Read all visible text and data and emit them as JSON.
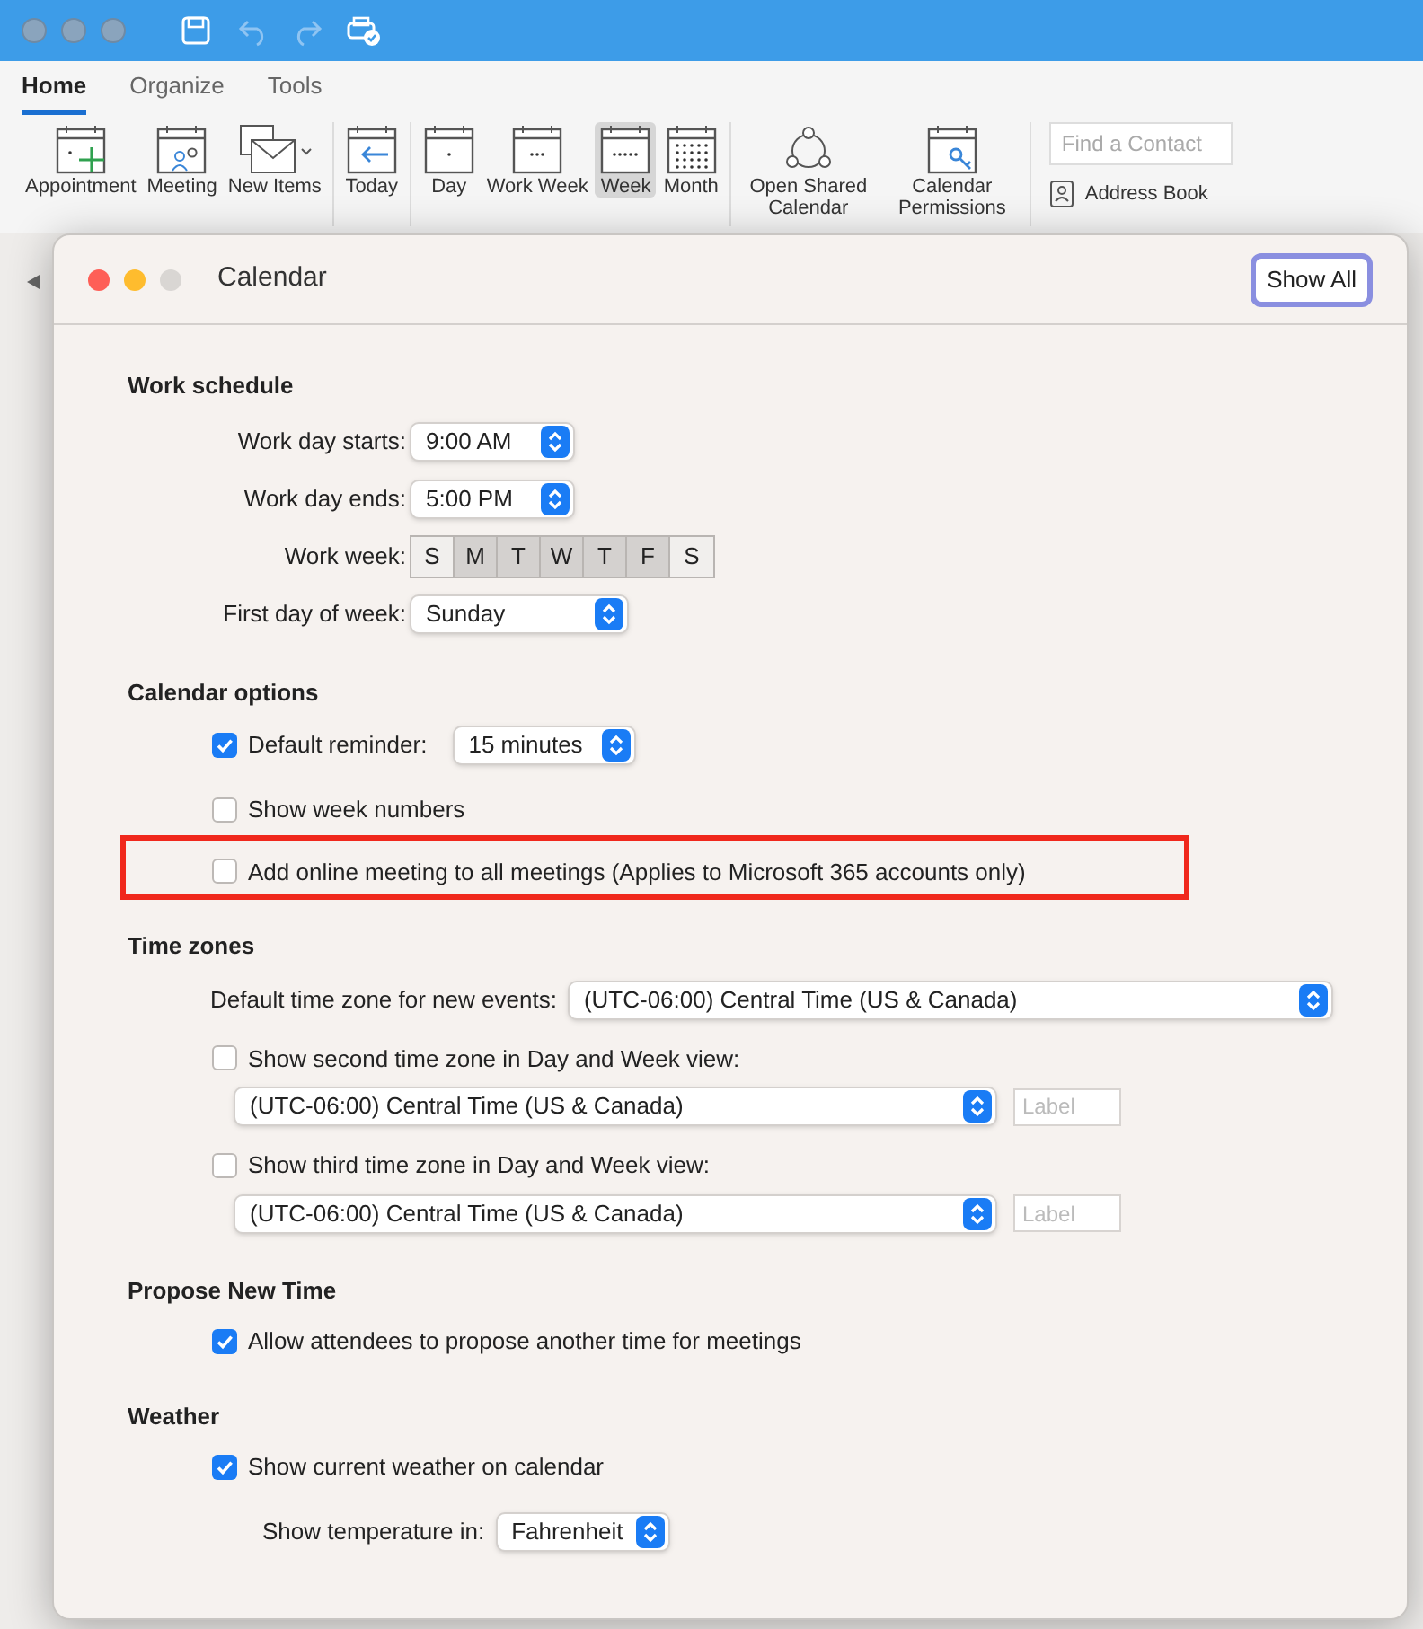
{
  "app": {
    "tabs": [
      {
        "label": "Home",
        "selected": true
      },
      {
        "label": "Organize",
        "selected": false
      },
      {
        "label": "Tools",
        "selected": false
      }
    ],
    "ribbon": [
      [
        {
          "kind": "appointment",
          "label": "Appointment",
          "selected": false
        },
        {
          "kind": "meeting",
          "label": "Meeting",
          "selected": false
        },
        {
          "kind": "new",
          "label": "New Items",
          "selected": false
        }
      ],
      [
        {
          "kind": "today",
          "label": "Today",
          "selected": false
        }
      ],
      [
        {
          "kind": "day",
          "label": "Day",
          "selected": false
        },
        {
          "kind": "workweek",
          "label": "Work Week",
          "selected": false
        },
        {
          "kind": "week",
          "label": "Week",
          "selected": true
        },
        {
          "kind": "month",
          "label": "Month",
          "selected": false
        }
      ],
      [
        {
          "kind": "shared",
          "label": "Open Shared Calendar",
          "selected": false
        },
        {
          "kind": "permissions",
          "label": "Calendar Permissions",
          "selected": false
        }
      ]
    ],
    "search": {
      "placeholder": "Find a Contact"
    },
    "address_book": "Address Book"
  },
  "dialog": {
    "title": "Calendar",
    "show_all": "Show All",
    "sections": [
      {
        "kind": "form",
        "title": "Work schedule",
        "rows": [
          {
            "kind": "time_select",
            "label": "Work day starts:",
            "value": "9:00 AM"
          },
          {
            "kind": "time_select",
            "label": "Work day ends:",
            "value": "5:00 PM"
          },
          {
            "kind": "weekdays",
            "label": "Work week:",
            "days": [
              {
                "label": "S",
                "selected": false
              },
              {
                "label": "M",
                "selected": true
              },
              {
                "label": "T",
                "selected": true
              },
              {
                "label": "W",
                "selected": true
              },
              {
                "label": "T",
                "selected": true
              },
              {
                "label": "F",
                "selected": true
              },
              {
                "label": "S",
                "selected": false
              }
            ]
          },
          {
            "kind": "day_select",
            "label": "First day of week:",
            "value": "Sunday"
          }
        ]
      },
      {
        "kind": "list",
        "title": "Calendar options",
        "rows": [
          {
            "kind": "checkbox",
            "label": "Default reminder:",
            "checked": true,
            "value": "15 minutes",
            "highlighted": false
          },
          {
            "kind": "checkbox",
            "label": "Show week numbers",
            "checked": false,
            "highlighted": false
          },
          {
            "kind": "checkbox",
            "label": "Add online meeting to all meetings (Applies to Microsoft 365 accounts only)",
            "checked": false,
            "highlighted": true
          }
        ]
      },
      {
        "kind": "list",
        "title": "Time zones",
        "rows": [
          {
            "kind": "wide_select",
            "label": "Default time zone for new events:",
            "value": "(UTC-06:00) Central Time (US & Canada)"
          },
          {
            "kind": "zone",
            "label": "Show second time zone in Day and Week view:",
            "checked": false,
            "value": "(UTC-06:00) Central Time (US & Canada)",
            "placeholder": "Label"
          },
          {
            "kind": "zone",
            "label": "Show third time zone in Day and Week view:",
            "checked": false,
            "value": "(UTC-06:00) Central Time (US & Canada)",
            "placeholder": "Label"
          }
        ]
      },
      {
        "kind": "list",
        "title": "Propose New Time",
        "rows": [
          {
            "kind": "checkbox",
            "label": "Allow attendees to propose another time for meetings",
            "checked": true,
            "highlighted": false
          }
        ]
      },
      {
        "kind": "list",
        "title": "Weather",
        "rows": [
          {
            "kind": "checkbox",
            "label": "Show current weather on calendar",
            "checked": true,
            "highlighted": false
          },
          {
            "kind": "sub_select",
            "label": "Show temperature in:",
            "value": "Fahrenheit"
          }
        ]
      }
    ]
  }
}
